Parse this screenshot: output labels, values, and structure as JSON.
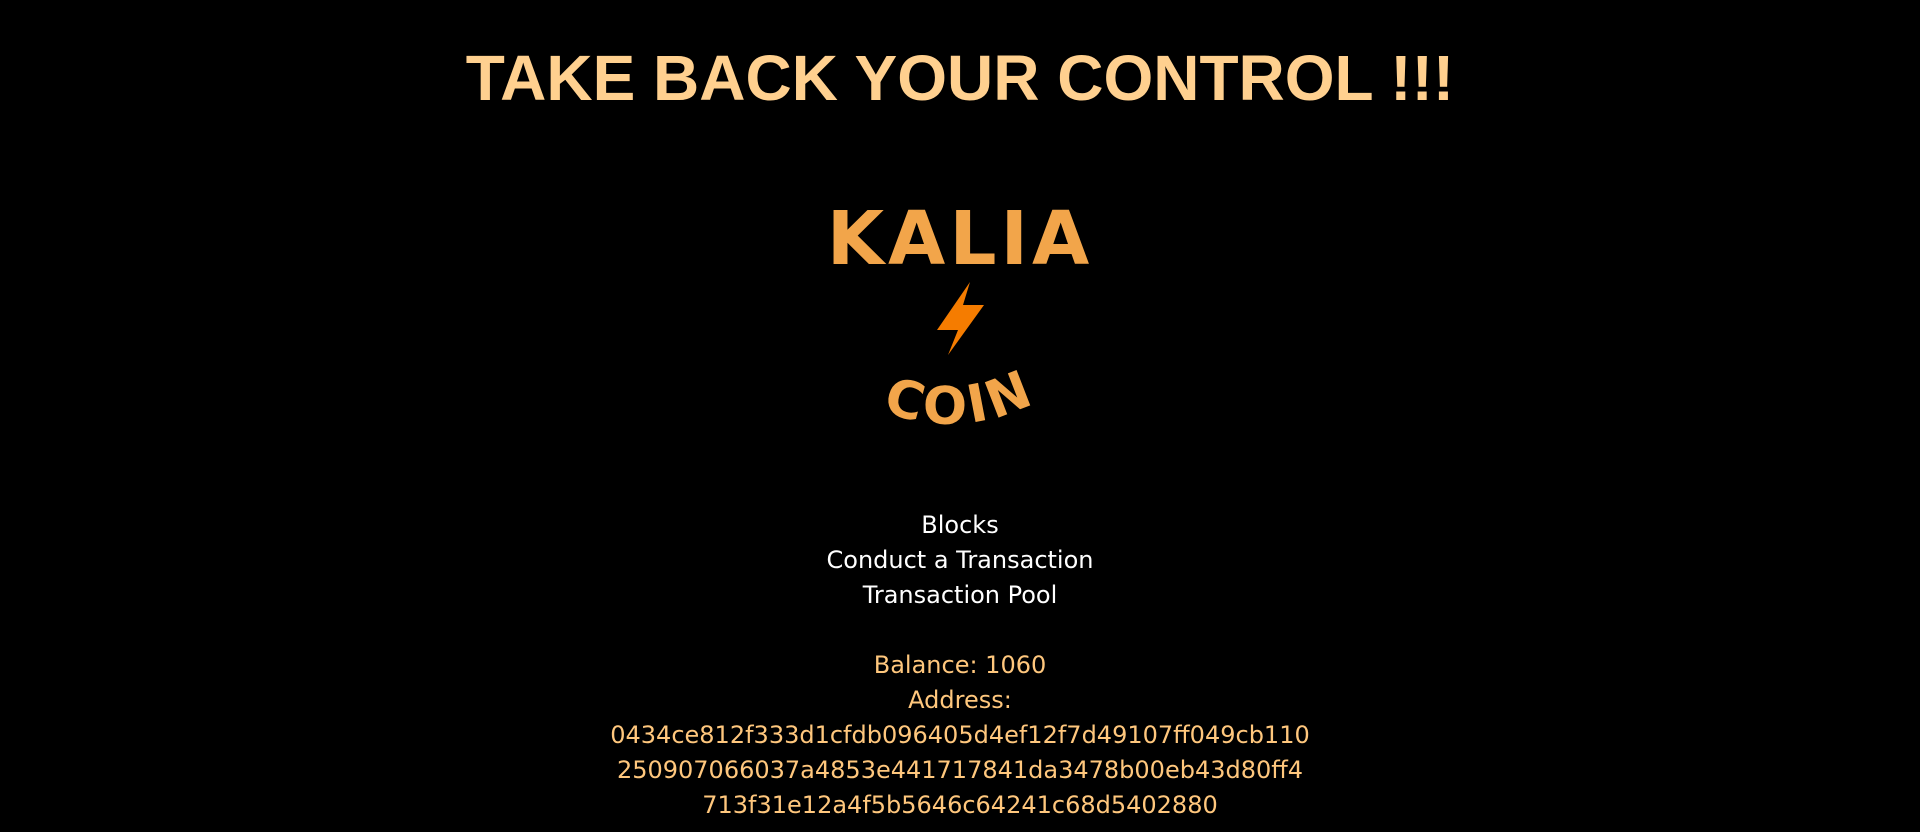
{
  "header": {
    "title": "TAKE BACK YOUR CONTROL !!!"
  },
  "logo": {
    "top_text": "KALIA",
    "bottom_text": "COIN",
    "icon": "lightning-bolt-icon",
    "colors": {
      "lettering": "#f2a54a",
      "bolt": "#f57c00"
    }
  },
  "nav": {
    "items": [
      {
        "label": "Blocks"
      },
      {
        "label": "Conduct a Transaction"
      },
      {
        "label": "Transaction Pool"
      }
    ]
  },
  "wallet": {
    "balance_label": "Balance: 1060",
    "address_label": "Address:",
    "address_lines": [
      "0434ce812f333d1cfdb096405d4ef12f7d49107ff049cb110",
      "250907066037a4853e441717841da3478b00eb43d80ff4",
      "713f31e12a4f5b5646c64241c68d5402880"
    ]
  },
  "theme": {
    "background": "#000000",
    "headline_color": "#ffd08f",
    "nav_color": "#ffffff",
    "wallet_color": "#ffc77d"
  }
}
